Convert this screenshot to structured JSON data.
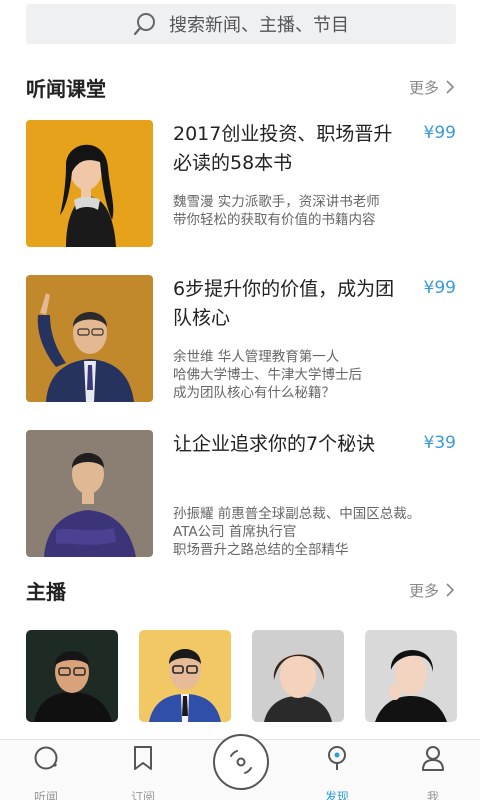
{
  "search": {
    "placeholder": "搜索新闻、主播、节目"
  },
  "courses_section": {
    "title": "听闻课堂",
    "more_label": "更多",
    "items": [
      {
        "title": "2017创业投资、职场晋升必读的58本书",
        "price": "¥99",
        "desc": [
          "魏雪漫 实力派歌手，资深讲书老师",
          "带你轻松的获取有价值的书籍内容"
        ]
      },
      {
        "title": "6步提升你的价值，成为团队核心",
        "price": "¥99",
        "desc": [
          "余世维 华人管理教育第一人",
          "哈佛大学博士、牛津大学博士后",
          "成为团队核心有什么秘籍？"
        ]
      },
      {
        "title": "让企业追求你的7个秘诀",
        "price": "¥39",
        "desc": [
          "孙振耀 前惠普全球副总裁、中国区总裁。",
          "ATA公司 首席执行官",
          "职场晋升之路总结的全部精华"
        ]
      }
    ]
  },
  "hosts_section": {
    "title": "主播",
    "more_label": "更多"
  },
  "tabbar": {
    "tabs": [
      {
        "label": "听闻",
        "icon": "listen-icon",
        "active": false
      },
      {
        "label": "订阅",
        "icon": "bookmark-icon",
        "active": false
      },
      {
        "label": "",
        "icon": "record-icon",
        "active": false
      },
      {
        "label": "发现",
        "icon": "discover-icon",
        "active": true
      },
      {
        "label": "我",
        "icon": "person-icon",
        "active": false
      }
    ]
  },
  "colors": {
    "accent": "#2a9fd8",
    "price": "#3a9bd9",
    "search_bg": "#eef0f2"
  }
}
